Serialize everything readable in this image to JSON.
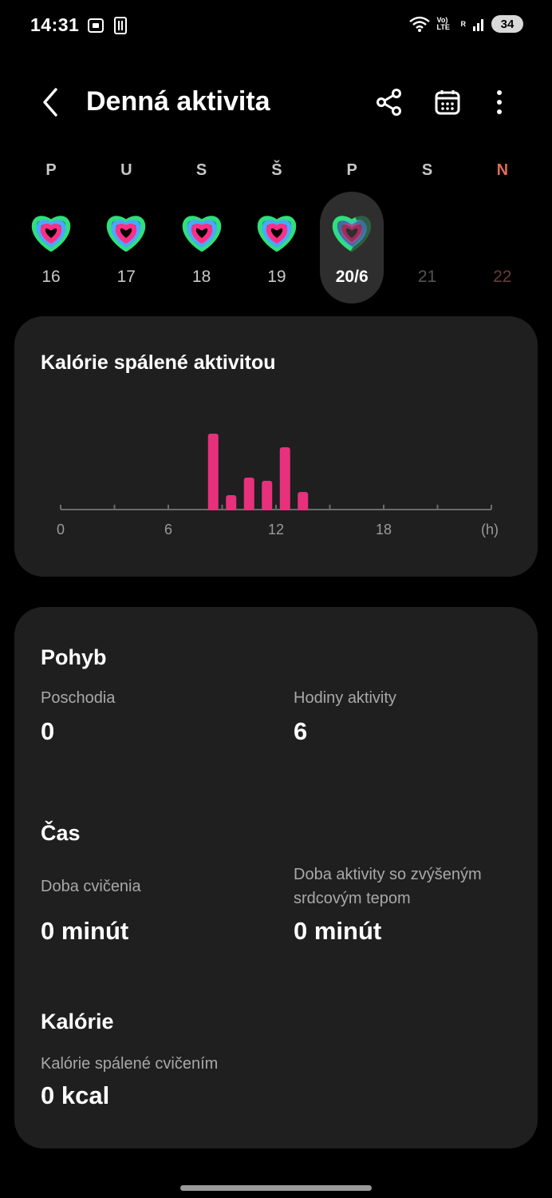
{
  "status_bar": {
    "time": "14:31",
    "signal_text": "Vo) LTE",
    "signal_r": "R",
    "battery": "34"
  },
  "header": {
    "title": "Denná aktivita"
  },
  "week": [
    {
      "name": "P",
      "num": "16",
      "state": "done"
    },
    {
      "name": "U",
      "num": "17",
      "state": "done"
    },
    {
      "name": "S",
      "num": "18",
      "state": "done"
    },
    {
      "name": "Š",
      "num": "19",
      "state": "done"
    },
    {
      "name": "P",
      "num": "20/6",
      "state": "selected"
    },
    {
      "name": "S",
      "num": "21",
      "state": "future"
    },
    {
      "name": "N",
      "num": "22",
      "state": "future-sunday"
    }
  ],
  "calories_card": {
    "title": "Kalórie spálené aktivitou"
  },
  "chart_data": {
    "type": "bar",
    "title": "Kalórie spálené aktivitou",
    "x_ticks": [
      "0",
      "6",
      "12",
      "18",
      "(h)"
    ],
    "xlim": [
      0,
      24
    ],
    "bar_color": "#e8317c",
    "x": [
      8,
      9,
      10,
      11,
      12,
      13
    ],
    "values": [
      95,
      18,
      40,
      36,
      78,
      22
    ],
    "ylim": [
      0,
      100
    ]
  },
  "summary_card": {
    "movement": {
      "title": "Pohyb",
      "floors_label": "Poschodia",
      "floors_value": "0",
      "active_hours_label": "Hodiny aktivity",
      "active_hours_value": "6"
    },
    "time": {
      "title": "Čas",
      "exercise_label": "Doba cvičenia",
      "exercise_value": "0 minút",
      "hr_label_line1": "Doba aktivity so zvýšeným",
      "hr_label_line2": "srdcovým tepom",
      "hr_value": "0 minút"
    },
    "calories": {
      "title": "Kalórie",
      "burned_label": "Kalórie spálené cvičením",
      "burned_value": "0 kcal"
    }
  },
  "colors": {
    "ring_outer": "#2ee07a",
    "ring_middle": "#4aa8ff",
    "ring_inner": "#ff2f86",
    "accent_sunday": "#e06a5a"
  }
}
